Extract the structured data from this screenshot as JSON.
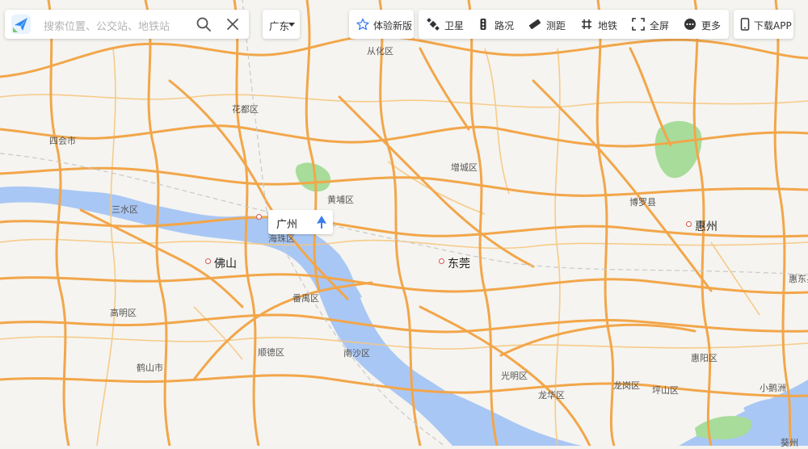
{
  "search": {
    "placeholder": "搜索位置、公交站、地铁站"
  },
  "city_select": {
    "label": "广东"
  },
  "toolbar": {
    "new_version": "体验新版",
    "satellite": "卫星",
    "traffic": "路况",
    "measure": "测距",
    "subway": "地铁",
    "fullscreen": "全屏",
    "more": "更多",
    "download": "下载APP"
  },
  "map": {
    "labels": {
      "conghua": "从化区",
      "huadu": "花都区",
      "sihui": "四会市",
      "sanshui": "三水区",
      "zengcheng": "增城区",
      "huangpu": "黄埔区",
      "boluo": "博罗县",
      "huizhou": "惠州",
      "foshan": "佛山",
      "haizhu": "海珠区",
      "dongguan": "东莞",
      "panyu": "番禺区",
      "gaoming": "高明区",
      "shunde": "顺德区",
      "nansha": "南沙区",
      "heshan": "鹤山市",
      "guangming": "光明区",
      "longhua": "龙华区",
      "longgang": "龙岗区",
      "pingshan": "坪山区",
      "huiyang": "惠阳区",
      "xiaomeisha": "小鹅洲",
      "huidong": "惠东县",
      "kuizhou": "葵州",
      "guangzhou_card": "广州"
    }
  },
  "colors": {
    "road": "#f2a64a",
    "road_minor": "#f7c77f",
    "water": "#a9c7f4",
    "park": "#a8dc9a",
    "accent": "#3a7cf0"
  }
}
